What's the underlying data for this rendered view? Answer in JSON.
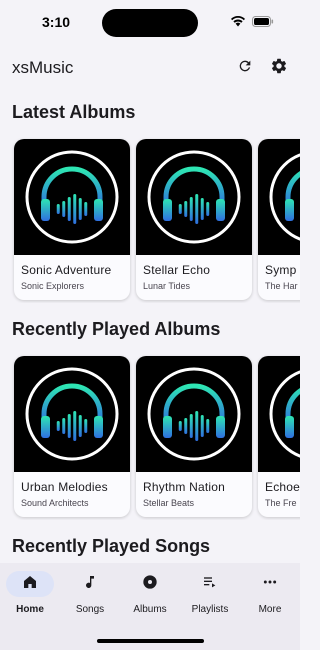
{
  "status_bar": {
    "time": "3:10"
  },
  "app_bar": {
    "title": "xsMusic",
    "actions": [
      "refresh-icon",
      "gear-icon"
    ]
  },
  "sections": {
    "latest_albums": {
      "title": "Latest Albums",
      "albums": [
        {
          "title": "Sonic Adventure",
          "artist": "Sonic Explorers"
        },
        {
          "title": "Stellar Echo",
          "artist": "Lunar Tides"
        },
        {
          "title": "Symp",
          "artist": "The Har"
        }
      ]
    },
    "recently_played_albums": {
      "title": "Recently Played Albums",
      "albums": [
        {
          "title": "Urban Melodies",
          "artist": "Sound Architects"
        },
        {
          "title": "Rhythm Nation",
          "artist": "Stellar Beats"
        },
        {
          "title": "Echoe",
          "artist": "The Fre"
        }
      ]
    },
    "recently_played_songs": {
      "title": "Recently Played Songs"
    }
  },
  "bottom_nav": {
    "items": [
      {
        "label": "Home",
        "icon": "home-icon",
        "active": true
      },
      {
        "label": "Songs",
        "icon": "music-note-icon",
        "active": false
      },
      {
        "label": "Albums",
        "icon": "album-icon",
        "active": false
      },
      {
        "label": "Playlists",
        "icon": "playlist-play-icon",
        "active": false
      },
      {
        "label": "More",
        "icon": "more-horiz-icon",
        "active": false
      }
    ]
  },
  "colors": {
    "background": "#f4f3f8",
    "nav_background": "#eceaf1",
    "nav_active_pill": "#dde3f7",
    "art_gradient_top": "#2ee6b3",
    "art_gradient_bottom": "#2f6fe0"
  }
}
